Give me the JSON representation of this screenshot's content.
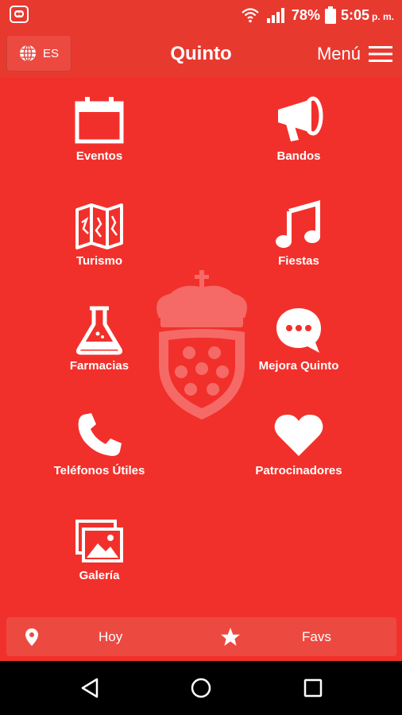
{
  "status": {
    "battery": "78%",
    "time": "5:05",
    "ampm": "p. m."
  },
  "header": {
    "language": "ES",
    "title": "Quinto",
    "menu_label": "Menú"
  },
  "grid": [
    {
      "label": "Eventos",
      "icon": "calendar-icon"
    },
    {
      "label": "Bandos",
      "icon": "megaphone-icon"
    },
    {
      "label": "Turismo",
      "icon": "map-icon"
    },
    {
      "label": "Fiestas",
      "icon": "music-note-icon"
    },
    {
      "label": "Farmacias",
      "icon": "flask-icon"
    },
    {
      "label": "Mejora Quinto",
      "icon": "chat-bubble-icon"
    },
    {
      "label": "Teléfonos Útiles",
      "icon": "phone-icon"
    },
    {
      "label": "Patrocinadores",
      "icon": "heart-icon"
    },
    {
      "label": "Galería",
      "icon": "gallery-icon"
    }
  ],
  "bottom_bar": {
    "today_label": "Hoy",
    "favs_label": "Favs"
  },
  "colors": {
    "background": "#f2302b",
    "header": "#e8392f"
  }
}
